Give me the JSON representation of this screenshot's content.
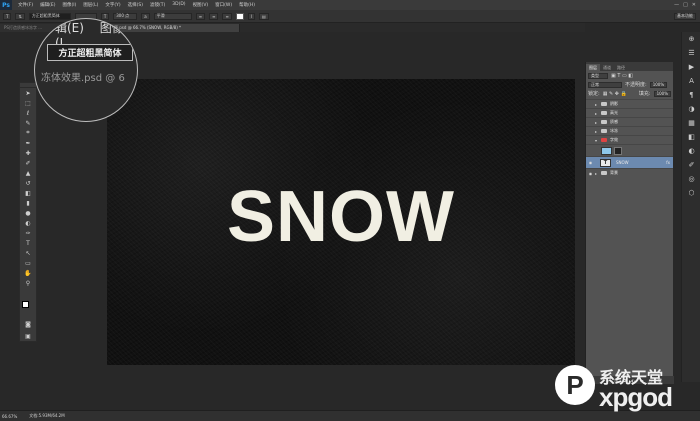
{
  "app": {
    "logo": "Ps"
  },
  "menu": [
    "文件(F)",
    "编辑(E)",
    "图像(I)",
    "图层(L)",
    "文字(Y)",
    "选择(S)",
    "滤镜(T)",
    "3D(D)",
    "视图(V)",
    "窗口(W)",
    "帮助(H)"
  ],
  "window_controls": [
    "—",
    "□",
    "✕"
  ],
  "options": {
    "tool": "T",
    "font_family": "方正超粗黑简体",
    "font_size": "300 点",
    "anti_alias": "平滑",
    "workspace": "基本功能"
  },
  "tabs": [
    {
      "label": "PS打造质感冰冻字 ..."
    },
    {
      "label": "质感冰冻字原.psd @ 66.7% (SNOW, RGB/8) *"
    }
  ],
  "magnifier": {
    "menu_a": "辑(E)",
    "menu_b": "图像(I",
    "font_name": "方正超粗黑简体",
    "doc_label": "冻体效果.psd @ 6"
  },
  "canvas": {
    "text": "SNOW"
  },
  "layers_panel": {
    "tabs": [
      "图层",
      "通道",
      "路径"
    ],
    "kind_filter": "类型",
    "blend_mode": "正常",
    "opacity_label": "不透明度:",
    "opacity": "100%",
    "lock_label": "锁定:",
    "fill_label": "填充:",
    "fill": "100%",
    "layers": [
      {
        "name": "阴影",
        "type": "group"
      },
      {
        "name": "高光",
        "type": "group"
      },
      {
        "name": "质感",
        "type": "group"
      },
      {
        "name": "冰冻",
        "type": "group"
      },
      {
        "name": "字效",
        "type": "group-open"
      },
      {
        "name": "",
        "type": "fill"
      },
      {
        "name": "SNOW",
        "type": "text",
        "fx": "fx"
      },
      {
        "name": "背景",
        "type": "group"
      }
    ]
  },
  "status": {
    "zoom": "66.67%",
    "doc": "文档:5.93M/64.2M"
  },
  "watermark": {
    "cn": "系统天堂",
    "en": "xpgod"
  }
}
